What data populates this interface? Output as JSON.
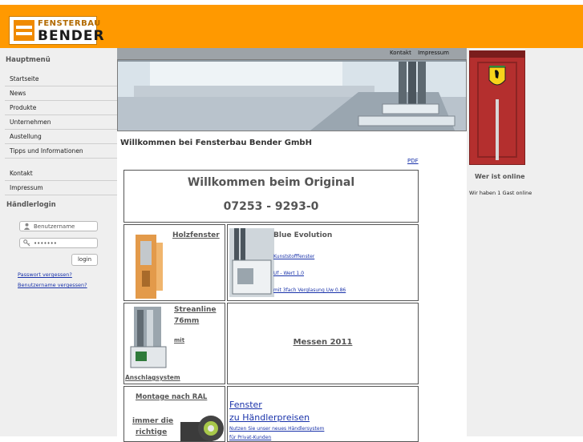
{
  "header": {
    "logo_line1": "FENSTERBAU",
    "logo_line2": "BENDER"
  },
  "sidebar": {
    "menu_title": "Hauptmenü",
    "items": [
      {
        "label": "Startseite"
      },
      {
        "label": "News"
      },
      {
        "label": "Produkte"
      },
      {
        "label": "Unternehmen"
      },
      {
        "label": "Austellung"
      },
      {
        "label": "Tipps und Informationen"
      },
      {
        "label": "Kontakt"
      },
      {
        "label": "Impressum"
      }
    ],
    "login_title": "Händlerlogin",
    "username_placeholder": "Benutzername",
    "password_value": "•••••••",
    "login_button": "login",
    "forgot_password": "Passwort vergessen?",
    "forgot_username": "Benutzername vergessen?"
  },
  "topbar": {
    "links": [
      "Kontakt",
      "Impressum"
    ]
  },
  "main": {
    "heading": "Willkommen bei Fensterbau Bender GmbH",
    "pdf_link": "PDF",
    "welcome_title": "Willkommen beim Original",
    "phone": "07253 - 9293-0",
    "cells": {
      "holz": "Holzfenster",
      "blue_title": "Blue Evolution",
      "blue_l1": "Kunststofffenster",
      "blue_l2": "Uf - Wert 1.0",
      "blue_l3": "mit 3fach Verglasung Uw 0.86",
      "stream_l1": "Streanline",
      "stream_l2": "76mm",
      "stream_l3": "mit",
      "stream_l4": "Anschlagsystem",
      "messen": "Messen 2011",
      "montage_l1": "Montage nach RAL",
      "montage_l2": "immer die",
      "montage_l3": "richtige",
      "fenster_l1": "Fenster",
      "fenster_l2": "zu Händlerpreisen",
      "fenster_l3": "Nutzen Sie unser neues Händlersystem",
      "fenster_l4": "für Privat-Kunden"
    }
  },
  "right": {
    "online_title": "Wer ist online",
    "online_text": "Wir haben 1 Gast online"
  },
  "colors": {
    "header": "#ff9900",
    "sidebar": "#efefef",
    "link": "#1a33aa"
  }
}
